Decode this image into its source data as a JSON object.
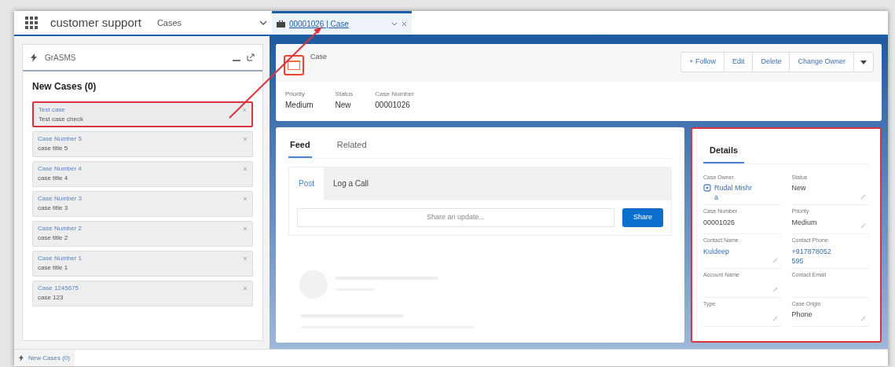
{
  "nav": {
    "app_name": "customer support",
    "object": "Cases",
    "tab": {
      "label": "00001026 | Case",
      "selected": true
    }
  },
  "utility_panel": {
    "title": "GrASMS",
    "list_title": "New Cases (0)",
    "cases": [
      {
        "title": "Test case",
        "subtitle": "Test case check",
        "highlighted": true
      },
      {
        "title": "Case Number 5",
        "subtitle": "case title 5",
        "highlighted": false
      },
      {
        "title": "Case Number 4",
        "subtitle": "case title 4",
        "highlighted": false
      },
      {
        "title": "Case Number 3",
        "subtitle": "case title 3",
        "highlighted": false
      },
      {
        "title": "Case Number 2",
        "subtitle": "case title 2",
        "highlighted": false
      },
      {
        "title": "Case Number 1",
        "subtitle": "case title 1",
        "highlighted": false
      },
      {
        "title": "Case 1245675",
        "subtitle": "case 123",
        "highlighted": false
      }
    ]
  },
  "utility_bar": {
    "label": "New Cases (0)"
  },
  "record_header": {
    "object": "Case",
    "actions": [
      "+ Follow",
      "Edit",
      "Delete",
      "Change Owner"
    ],
    "fields": [
      {
        "label": "Priority",
        "value": "Medium"
      },
      {
        "label": "Status",
        "value": "New"
      },
      {
        "label": "Case Number",
        "value": "00001026"
      }
    ]
  },
  "feed": {
    "tabs": [
      {
        "label": "Feed",
        "selected": true
      },
      {
        "label": "Related",
        "selected": false
      }
    ],
    "publisher_tabs": [
      {
        "label": "Post",
        "selected": true
      },
      {
        "label": "Log a Call",
        "selected": false
      }
    ],
    "share_placeholder": "Share an update...",
    "share_button": "Share"
  },
  "details": {
    "title": "Details",
    "fields": [
      {
        "label": "Case Owner",
        "value": "Rudal Mishra",
        "kind": "user",
        "editable": false
      },
      {
        "label": "Status",
        "value": "New",
        "kind": "text",
        "editable": true
      },
      {
        "label": "Case Number",
        "value": "00001026",
        "kind": "text",
        "editable": false
      },
      {
        "label": "Priority",
        "value": "Medium",
        "kind": "text",
        "editable": true
      },
      {
        "label": "Contact Name",
        "value": "Kuldeep",
        "kind": "link",
        "editable": true
      },
      {
        "label": "Contact Phone",
        "value": "+917878052595",
        "kind": "link",
        "editable": false
      },
      {
        "label": "Account Name",
        "editable": true
      },
      {
        "label": "Contact Email",
        "editable": false
      },
      {
        "label": "Type",
        "editable": true
      },
      {
        "label": "Case Origin",
        "value": "Phone",
        "kind": "text",
        "editable": true
      }
    ]
  }
}
